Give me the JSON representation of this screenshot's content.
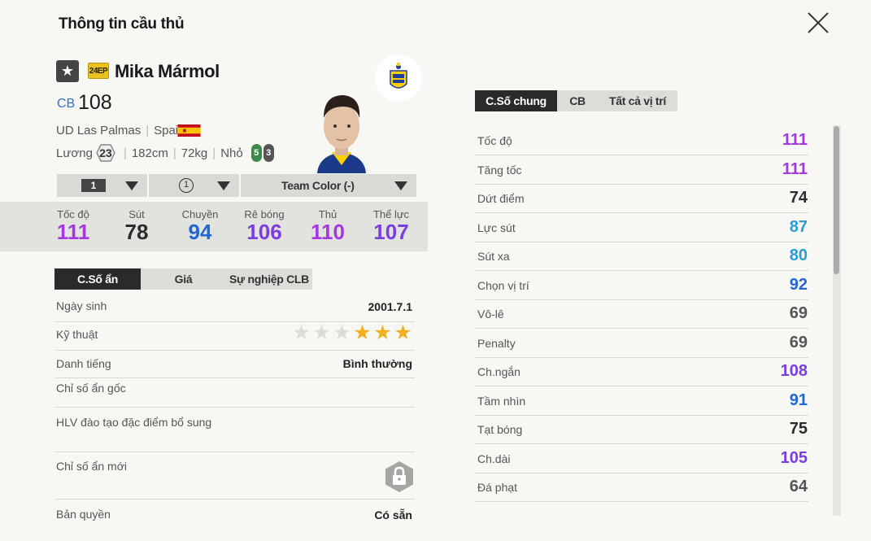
{
  "header": {
    "title": "Thông tin cầu thủ"
  },
  "player": {
    "name": "Mika Mármol",
    "season_badge": "24EP",
    "position": "CB",
    "ovr": "108",
    "club": "UD Las Palmas",
    "nation": "Spain",
    "salary_label": "Lương",
    "salary": "23",
    "height": "182cm",
    "weight": "72kg",
    "body": "Nhỏ",
    "weak_foot_left": "5",
    "weak_foot_right": "3"
  },
  "dropdowns": {
    "level": "1",
    "grade": "1",
    "team_color": "Team Color (-)"
  },
  "summary_stats": [
    {
      "label": "Tốc độ",
      "value": "111",
      "color": "#a437e0"
    },
    {
      "label": "Sút",
      "value": "78",
      "color": "#2b2b2b"
    },
    {
      "label": "Chuyền",
      "value": "94",
      "color": "#2166d6"
    },
    {
      "label": "Rê bóng",
      "value": "106",
      "color": "#7a3ee0"
    },
    {
      "label": "Thủ",
      "value": "110",
      "color": "#a437e0"
    },
    {
      "label": "Thể lực",
      "value": "107",
      "color": "#7a3ee0"
    }
  ],
  "left_tabs": [
    "C.Số ẩn",
    "Giá",
    "Sự nghiệp CLB"
  ],
  "hidden": {
    "birth_label": "Ngày sinh",
    "birth_value": "2001.7.1",
    "skill_label": "Kỹ thuật",
    "skill_stars": 3,
    "skill_max": 6,
    "fame_label": "Danh tiếng",
    "fame_value": "Bình thường",
    "base_hidden_label": "Chỉ số ẩn gốc",
    "coach_label": "HLV đào tạo đặc điểm bổ sung",
    "new_hidden_label": "Chỉ số ẩn mới",
    "license_label": "Bản quyền",
    "license_value": "Có sẵn"
  },
  "right_tabs": [
    "C.Số chung",
    "CB",
    "Tất cả vị trí"
  ],
  "attributes": [
    {
      "label": "Tốc độ",
      "value": "111",
      "color": "#a437e0"
    },
    {
      "label": "Tăng tốc",
      "value": "111",
      "color": "#a437e0"
    },
    {
      "label": "Dứt điểm",
      "value": "74",
      "color": "#2b2b2b"
    },
    {
      "label": "Lực sút",
      "value": "87",
      "color": "#2d9bd6"
    },
    {
      "label": "Sút xa",
      "value": "80",
      "color": "#2d9bd6"
    },
    {
      "label": "Chọn vị trí",
      "value": "92",
      "color": "#2166d6"
    },
    {
      "label": "Vô-lê",
      "value": "69",
      "color": "#555555"
    },
    {
      "label": "Penalty",
      "value": "69",
      "color": "#555555"
    },
    {
      "label": "Ch.ngắn",
      "value": "108",
      "color": "#7a3ee0"
    },
    {
      "label": "Tầm nhìn",
      "value": "91",
      "color": "#2166d6"
    },
    {
      "label": "Tạt bóng",
      "value": "75",
      "color": "#2b2b2b"
    },
    {
      "label": "Ch.dài",
      "value": "105",
      "color": "#7a3ee0"
    },
    {
      "label": "Đá phạt",
      "value": "64",
      "color": "#555555"
    }
  ]
}
